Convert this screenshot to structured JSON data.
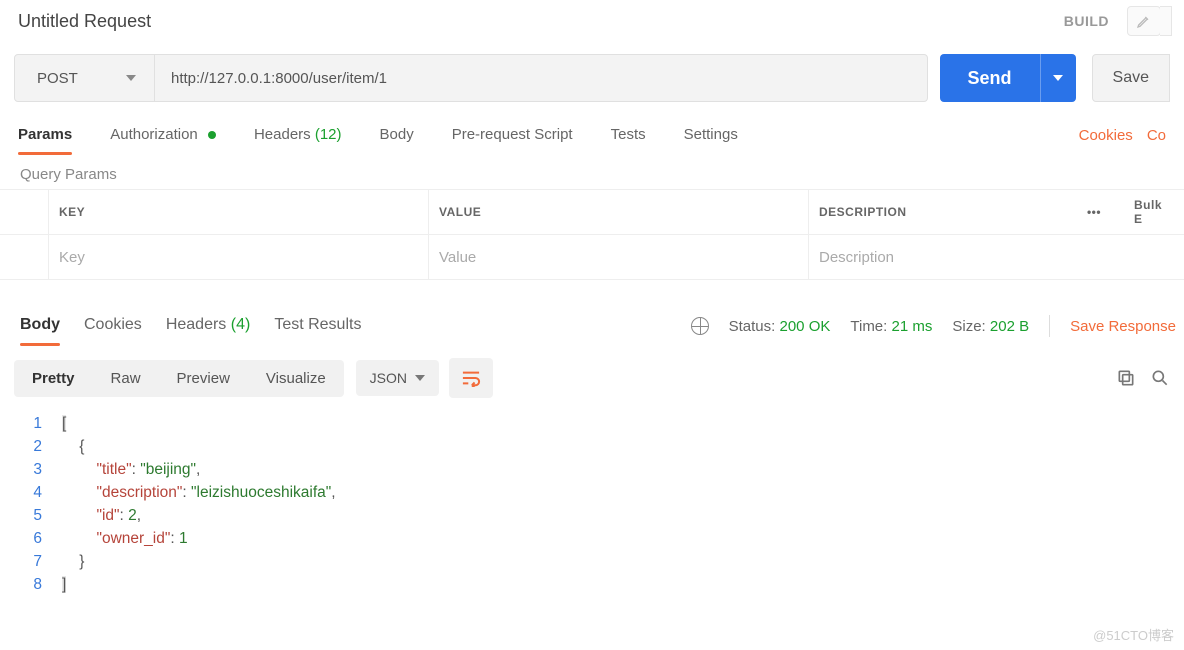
{
  "header": {
    "title": "Untitled Request",
    "build_label": "BUILD"
  },
  "request": {
    "method": "POST",
    "url": "http://127.0.0.1:8000/user/item/1",
    "send_label": "Send",
    "save_label": "Save"
  },
  "req_tabs": {
    "params": "Params",
    "authorization": "Authorization",
    "headers": "Headers",
    "headers_count": "(12)",
    "body": "Body",
    "prerequest": "Pre-request Script",
    "tests": "Tests",
    "settings": "Settings",
    "cookies_link": "Cookies",
    "code_link": "Co"
  },
  "query_params": {
    "section_label": "Query Params",
    "col_key": "KEY",
    "col_value": "VALUE",
    "col_desc": "DESCRIPTION",
    "bulk_label": "Bulk E",
    "ph_key": "Key",
    "ph_value": "Value",
    "ph_desc": "Description"
  },
  "resp_tabs": {
    "body": "Body",
    "cookies": "Cookies",
    "headers": "Headers",
    "headers_count": "(4)",
    "test_results": "Test Results"
  },
  "resp_meta": {
    "status_label": "Status:",
    "status_value": "200 OK",
    "time_label": "Time:",
    "time_value": "21 ms",
    "size_label": "Size:",
    "size_value": "202 B",
    "save_response": "Save Response"
  },
  "resp_toolbar": {
    "pretty": "Pretty",
    "raw": "Raw",
    "preview": "Preview",
    "visualize": "Visualize",
    "format": "JSON"
  },
  "response_body": {
    "lines": [
      {
        "n": "1",
        "html": "<span class='hl pun'>[</span>"
      },
      {
        "n": "2",
        "html": "    <span class='pun'>{</span>"
      },
      {
        "n": "3",
        "html": "        <span class='key'>\"title\"</span><span class='pun'>: </span><span class='str'>\"beijing\"</span><span class='pun'>,</span>"
      },
      {
        "n": "4",
        "html": "        <span class='key'>\"description\"</span><span class='pun'>: </span><span class='str'>\"leizishuoceshikaifa\"</span><span class='pun'>,</span>"
      },
      {
        "n": "5",
        "html": "        <span class='key'>\"id\"</span><span class='pun'>: </span><span class='num'>2</span><span class='pun'>,</span>"
      },
      {
        "n": "6",
        "html": "        <span class='key'>\"owner_id\"</span><span class='pun'>: </span><span class='num'>1</span>"
      },
      {
        "n": "7",
        "html": "    <span class='pun'>}</span>"
      },
      {
        "n": "8",
        "html": "<span class='hl pun'>]</span>"
      }
    ]
  },
  "watermark": "@51CTO博客"
}
